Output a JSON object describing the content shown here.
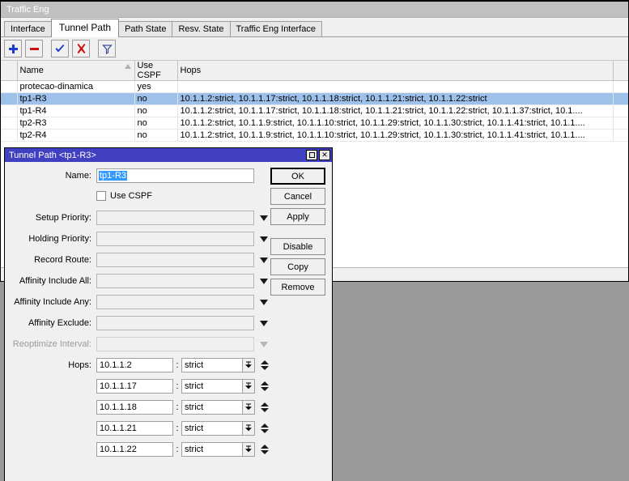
{
  "window": {
    "title": "Traffic Eng",
    "tabs": [
      {
        "label": "Interface",
        "active": false
      },
      {
        "label": "Tunnel Path",
        "active": true
      },
      {
        "label": "Path State",
        "active": false
      },
      {
        "label": "Resv. State",
        "active": false
      },
      {
        "label": "Traffic Eng Interface",
        "active": false
      }
    ],
    "toolbar": [
      {
        "name": "add-button",
        "icon": "plus-icon",
        "color": "#1e3ccc"
      },
      {
        "name": "remove-button",
        "icon": "minus-icon",
        "color": "#cc1111"
      },
      {
        "name": "enable-button",
        "icon": "check-icon",
        "color": "#1e3ccc"
      },
      {
        "name": "disable-button",
        "icon": "cross-icon",
        "color": "#cc1111"
      },
      {
        "name": "filter-button",
        "icon": "funnel-icon",
        "color": "#3b4f9e"
      }
    ]
  },
  "table": {
    "columns": [
      "",
      "Name",
      "Use CSPF",
      "Hops",
      ""
    ],
    "sort_column": "Name",
    "rows": [
      {
        "flag": "",
        "name": "protecao-dinamica",
        "use_cspf": "yes",
        "hops": "",
        "selected": false
      },
      {
        "flag": "",
        "name": "tp1-R3",
        "use_cspf": "no",
        "hops": "10.1.1.2:strict, 10.1.1.17:strict, 10.1.1.18:strict, 10.1.1.21:strict, 10.1.1.22:strict",
        "selected": true
      },
      {
        "flag": "",
        "name": "tp1-R4",
        "use_cspf": "no",
        "hops": "10.1.1.2:strict, 10.1.1.17:strict, 10.1.1.18:strict, 10.1.1.21:strict, 10.1.1.22:strict, 10.1.1.37:strict, 10.1....",
        "selected": false
      },
      {
        "flag": "",
        "name": "tp2-R3",
        "use_cspf": "no",
        "hops": "10.1.1.2:strict, 10.1.1.9:strict, 10.1.1.10:strict, 10.1.1.29:strict, 10.1.1.30:strict, 10.1.1.41:strict, 10.1.1....",
        "selected": false
      },
      {
        "flag": "",
        "name": "tp2-R4",
        "use_cspf": "no",
        "hops": "10.1.1.2:strict, 10.1.1.9:strict, 10.1.1.10:strict, 10.1.1.29:strict, 10.1.1.30:strict, 10.1.1.41:strict, 10.1.1....",
        "selected": false
      }
    ]
  },
  "dialog": {
    "title": "Tunnel Path <tp1-R3>",
    "title_buttons": [
      {
        "name": "maximize-button",
        "icon": "maximize-icon"
      },
      {
        "name": "close-button",
        "icon": "close-icon",
        "glyph": "✕"
      }
    ],
    "fields": {
      "name_label": "Name:",
      "name_value": "tp1-R3",
      "name_selected": true,
      "use_cspf_label": "Use CSPF",
      "use_cspf_checked": false,
      "setup_priority_label": "Setup Priority:",
      "setup_priority_value": "",
      "holding_priority_label": "Holding Priority:",
      "holding_priority_value": "",
      "record_route_label": "Record Route:",
      "record_route_value": "",
      "affinity_include_all_label": "Affinity Include All:",
      "affinity_include_all_value": "",
      "affinity_include_any_label": "Affinity Include Any:",
      "affinity_include_any_value": "",
      "affinity_exclude_label": "Affinity Exclude:",
      "affinity_exclude_value": "",
      "reoptimize_interval_label": "Reoptimize Interval:",
      "reoptimize_interval_value": "",
      "reoptimize_interval_disabled": true,
      "hops_label": "Hops:"
    },
    "hops": [
      {
        "ip": "10.1.1.2",
        "separator": ":",
        "type": "strict"
      },
      {
        "ip": "10.1.1.17",
        "separator": ":",
        "type": "strict"
      },
      {
        "ip": "10.1.1.18",
        "separator": ":",
        "type": "strict"
      },
      {
        "ip": "10.1.1.21",
        "separator": ":",
        "type": "strict"
      },
      {
        "ip": "10.1.1.22",
        "separator": ":",
        "type": "strict"
      }
    ],
    "buttons": [
      {
        "label": "OK",
        "name": "ok-button",
        "default": true
      },
      {
        "label": "Cancel",
        "name": "cancel-button",
        "default": false
      },
      {
        "label": "Apply",
        "name": "apply-button",
        "default": false
      },
      {
        "label": "Disable",
        "name": "disable-button",
        "default": false,
        "group_gap": true
      },
      {
        "label": "Copy",
        "name": "copy-button",
        "default": false
      },
      {
        "label": "Remove",
        "name": "remove-button",
        "default": false
      }
    ]
  },
  "colors": {
    "dialog_title_bg": "#4040c0",
    "window_title_bg": "#c0c0c0",
    "selection_row": "#9dc1ea",
    "text_selection": "#3399ff",
    "desktop": "#9a9a9a"
  }
}
